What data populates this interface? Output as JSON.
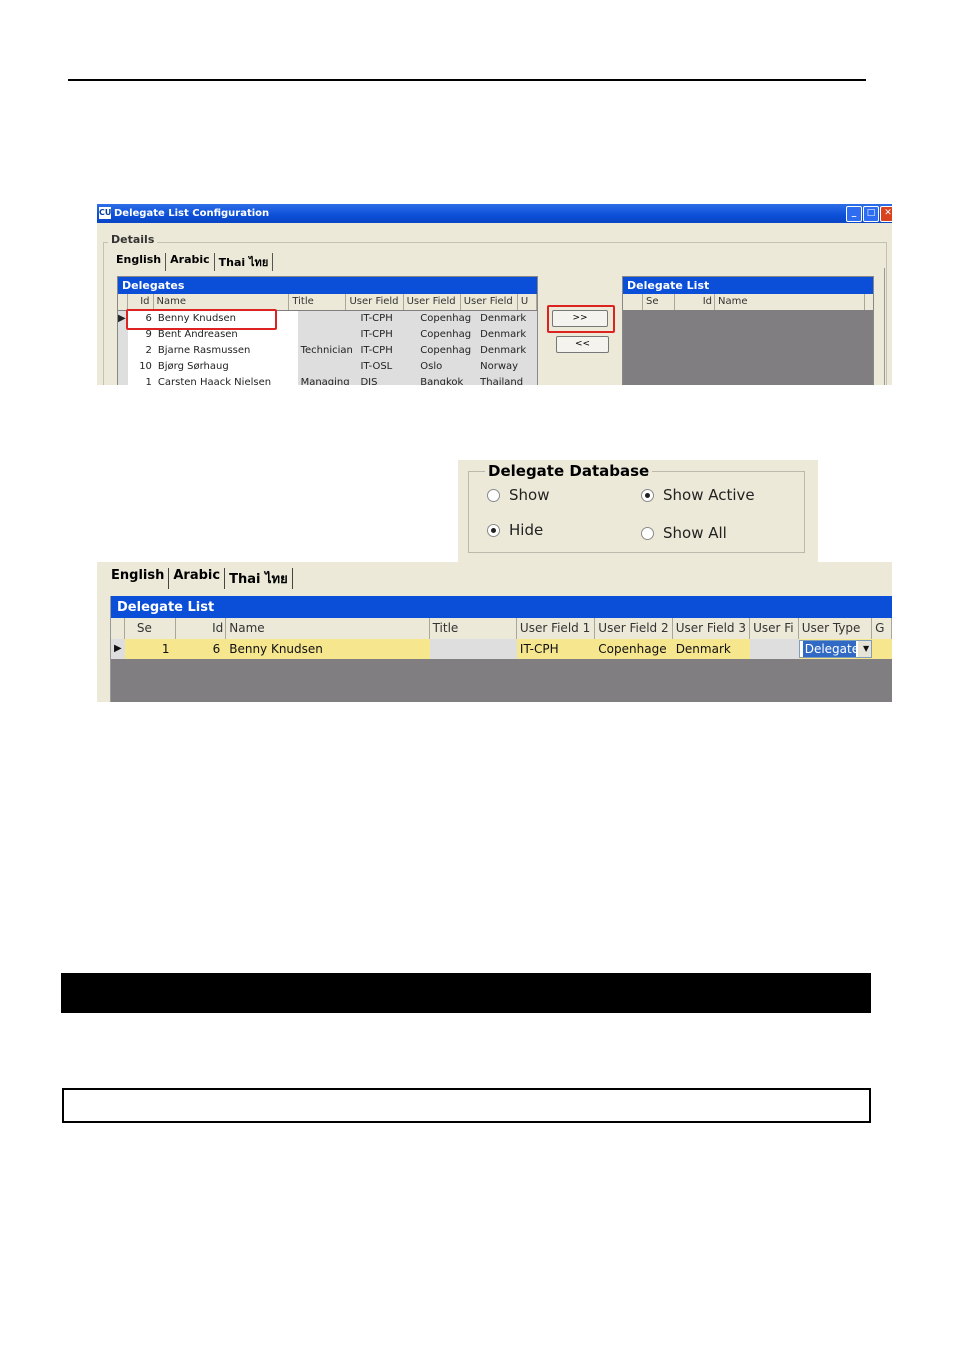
{
  "window1": {
    "title": "Delegate List Configuration",
    "app_icon_text": "CU",
    "controls": {
      "minimize": "_",
      "maximize": "□",
      "close": "✕"
    },
    "details_label": "Details",
    "tabs": [
      "English",
      "Arabic",
      "Thai ไทย"
    ],
    "delegates": {
      "header": "Delegates",
      "columns": [
        "Id",
        "Name",
        "Title",
        "User Field",
        "User Field",
        "User Field",
        "U"
      ],
      "rows": [
        {
          "id": "6",
          "name": "Benny Knudsen",
          "title": "",
          "uf1": "IT-CPH",
          "uf2": "Copenhag",
          "uf3": "Denmark"
        },
        {
          "id": "9",
          "name": "Bent Andreasen",
          "title": "",
          "uf1": "IT-CPH",
          "uf2": "Copenhag",
          "uf3": "Denmark"
        },
        {
          "id": "2",
          "name": "Bjarne Rasmussen",
          "title": "Technician",
          "uf1": "IT-CPH",
          "uf2": "Copenhag",
          "uf3": "Denmark"
        },
        {
          "id": "10",
          "name": "Bjørg Sørhaug",
          "title": "",
          "uf1": "IT-OSL",
          "uf2": "Oslo",
          "uf3": "Norway"
        },
        {
          "id": "1",
          "name": "Carsten Haack Nielsen",
          "title": "Managing",
          "uf1": "DIS",
          "uf2": "Bangkok",
          "uf3": "Thailand"
        }
      ]
    },
    "add_button": ">>",
    "remove_button": "<<",
    "delegate_list": {
      "header": "Delegate List",
      "columns": [
        "Se",
        "Id",
        "Name"
      ]
    }
  },
  "delegate_database": {
    "label": "Delegate Database",
    "options": [
      {
        "label": "Show",
        "checked": false
      },
      {
        "label": "Show Active",
        "checked": true
      },
      {
        "label": "Hide",
        "checked": true
      },
      {
        "label": "Show All",
        "checked": false
      }
    ]
  },
  "window3": {
    "tabs": [
      "English",
      "Arabic",
      "Thai ไทย"
    ],
    "panel_header": "Delegate List",
    "columns": [
      "Se",
      "Id",
      "Name",
      "Title",
      "User Field 1",
      "User Field 2",
      "User Field 3",
      "User Fi",
      "User Type",
      "G"
    ],
    "row": {
      "se": "1",
      "id": "6",
      "name": "Benny Knudsen",
      "title": "",
      "uf1": "IT-CPH",
      "uf2": "Copenhage",
      "uf3": "Denmark",
      "uf4": "",
      "user_type": "Delegate"
    }
  }
}
